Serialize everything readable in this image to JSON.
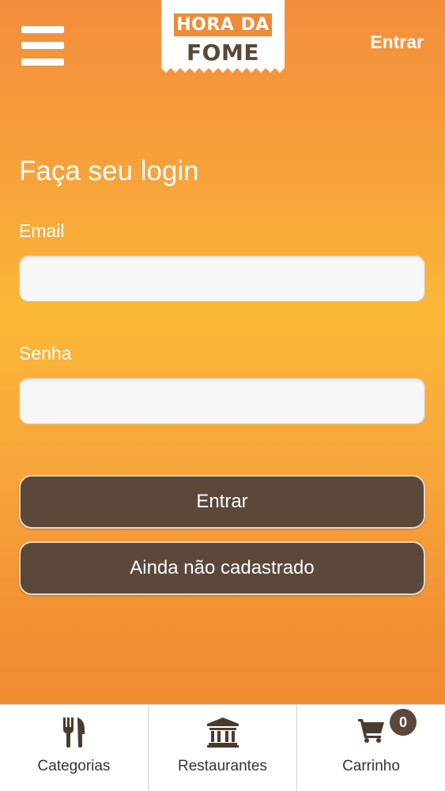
{
  "header": {
    "logo_line1": "HORA DA",
    "logo_line2": "FOME",
    "login_link": "Entrar"
  },
  "login_form": {
    "title": "Faça seu login",
    "email_label": "Email",
    "email_value": "",
    "password_label": "Senha",
    "password_value": "",
    "login_button": "Entrar",
    "register_button": "Ainda não cadastrado"
  },
  "bottom_nav": {
    "items": [
      {
        "label": "Categorias",
        "icon": "utensils-icon"
      },
      {
        "label": "Restaurantes",
        "icon": "building-icon"
      },
      {
        "label": "Carrinho",
        "icon": "cart-icon"
      }
    ],
    "cart_count": "0"
  },
  "colors": {
    "accent_orange": "#f7a23a",
    "brand_brown": "#5b483b",
    "white": "#ffffff"
  }
}
